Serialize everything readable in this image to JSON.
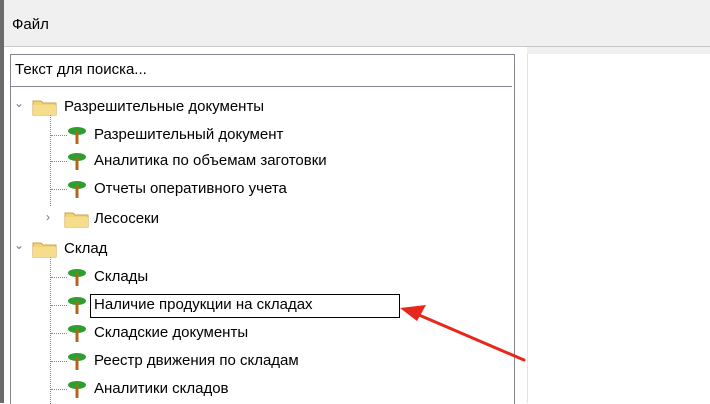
{
  "menubar": {
    "file_label": "Файл"
  },
  "search": {
    "placeholder": "Текст для поиска..."
  },
  "tree": {
    "groups": [
      {
        "label": "Разрешительные документы",
        "children": [
          "Разрешительный документ",
          "Аналитика по объемам заготовки",
          "Отчеты оперативного учета"
        ],
        "subfolder": "Лесосеки"
      },
      {
        "label": "Склад",
        "children": [
          "Склады",
          "Наличие продукции на складах",
          "Складские документы",
          "Реестр движения по складам",
          "Аналитики складов"
        ]
      }
    ],
    "selected": "Наличие продукции на складах"
  },
  "colors": {
    "folder": "#f3d27a",
    "tree_icon_leaf": "#2e9e2e",
    "tree_icon_trunk": "#b5641e",
    "arrow": "#e8271c"
  }
}
